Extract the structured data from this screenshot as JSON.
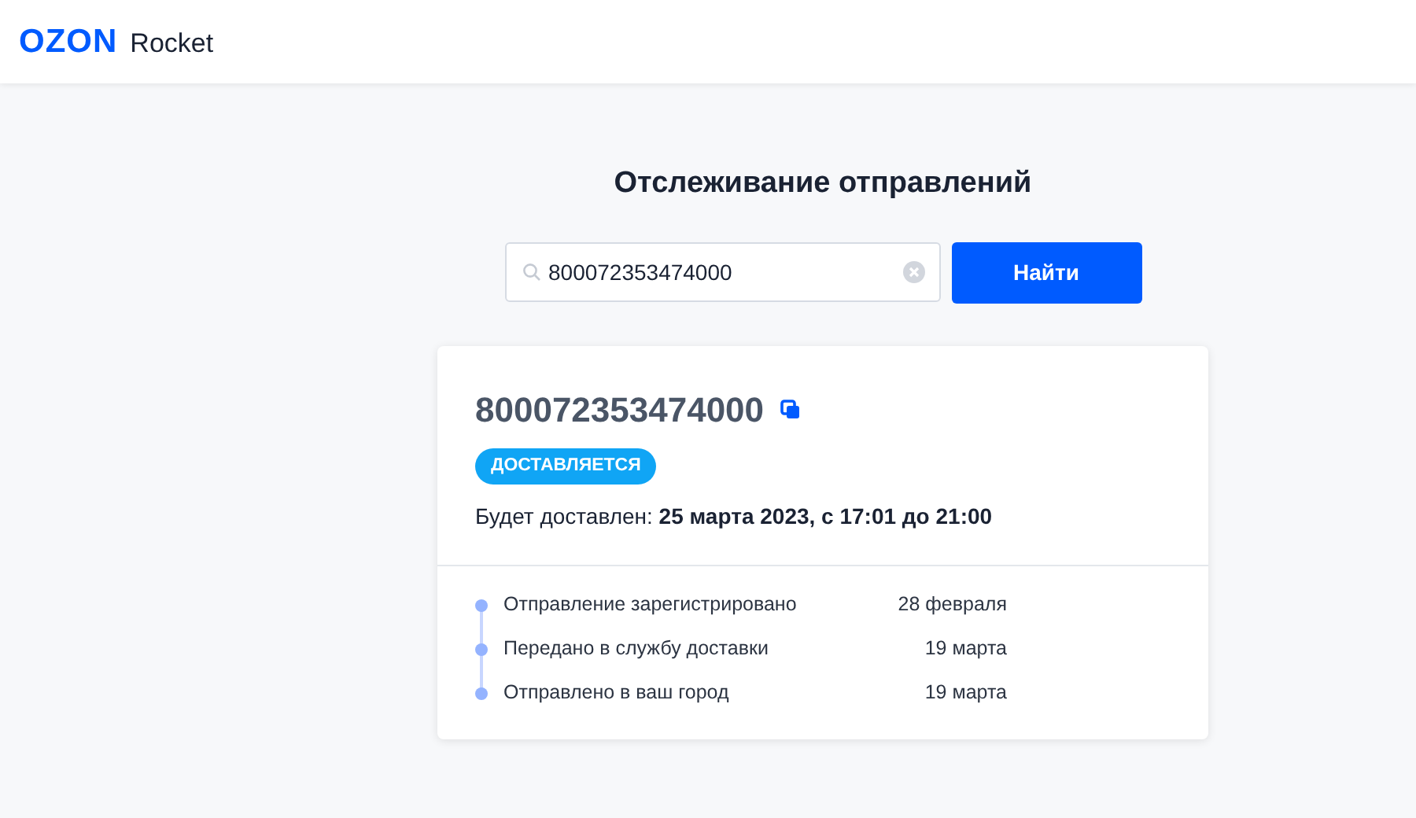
{
  "header": {
    "logo": "OZON",
    "product": "Rocket"
  },
  "page_title": "Отслеживание отправлений",
  "search": {
    "value": "800072353474000",
    "button": "Найти"
  },
  "shipment": {
    "number": "800072353474000",
    "status": "ДОСТАВЛЯЕТСЯ",
    "delivery": "Будет доставлен: **25 марта 2023, с 17:01 до 21:00**",
    "events": [
      {
        "label": "Отправление зарегистрировано",
        "date": "28 февраля"
      },
      {
        "label": "Передано в службу доставки",
        "date": "19 марта"
      },
      {
        "label": "Отправлено в ваш город",
        "date": "19 марта"
      }
    ]
  }
}
